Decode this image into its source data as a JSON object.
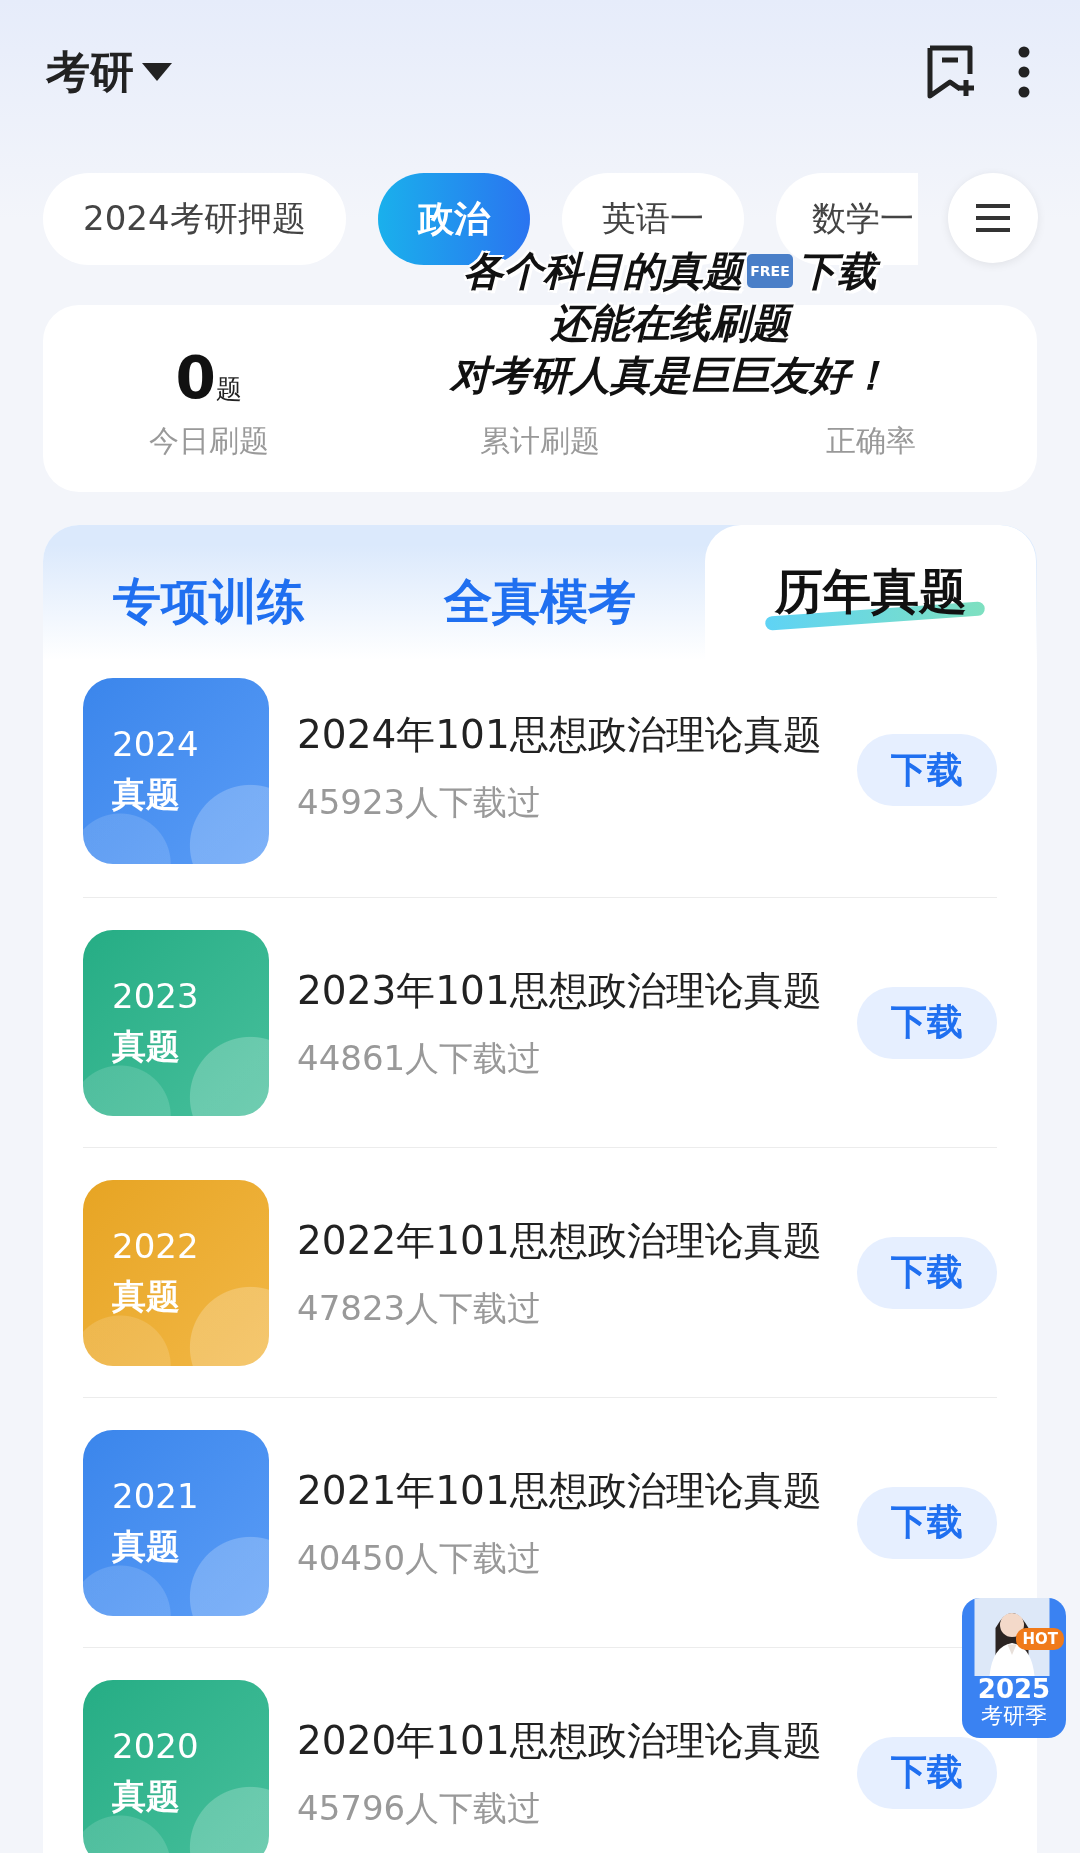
{
  "header": {
    "title": "考研"
  },
  "chips": [
    {
      "label": "2024考研押题",
      "selected": false
    },
    {
      "label": "政治",
      "selected": true
    },
    {
      "label": "英语一",
      "selected": false
    },
    {
      "label": "数学一",
      "selected": false
    }
  ],
  "stats": [
    {
      "value": "0",
      "unit": "题",
      "label": "今日刷题"
    },
    {
      "label": "累计刷题"
    },
    {
      "label": "正确率"
    }
  ],
  "caption": {
    "lines": [
      {
        "segments": [
          {
            "text": "各个科目的真题",
            "kind": "text"
          },
          {
            "text": "FREE",
            "kind": "badge"
          },
          {
            "text": "下载",
            "kind": "text"
          }
        ]
      },
      {
        "segments": [
          {
            "text": "还能在线刷题",
            "kind": "text"
          }
        ]
      },
      {
        "segments": [
          {
            "text": "对考研人真是巨巨友好！",
            "kind": "text"
          }
        ]
      }
    ]
  },
  "tabs": [
    {
      "label": "专项训练",
      "selected": false
    },
    {
      "label": "全真模考",
      "selected": false
    },
    {
      "label": "历年真题",
      "selected": true
    }
  ],
  "papers": [
    {
      "year": "2024",
      "tag": "真题",
      "color": "#3d8bf5",
      "title": "2024年101思想政治理论真题",
      "downloads": "45923人下载过",
      "button": "下载"
    },
    {
      "year": "2023",
      "tag": "真题",
      "color": "#27b48a",
      "title": "2023年101思想政治理论真题",
      "downloads": "44861人下载过",
      "button": "下载"
    },
    {
      "year": "2022",
      "tag": "真题",
      "color": "#f0ab25",
      "title": "2022年101思想政治理论真题",
      "downloads": "47823人下载过",
      "button": "下载"
    },
    {
      "year": "2021",
      "tag": "真题",
      "color": "#3d8bf5",
      "title": "2021年101思想政治理论真题",
      "downloads": "40450人下载过",
      "button": "下载"
    },
    {
      "year": "2020",
      "tag": "真题",
      "color": "#27b48a",
      "title": "2020年101思想政治理论真题",
      "downloads": "45796人下载过",
      "button": "下载"
    }
  ],
  "promo": {
    "badge": "HOT",
    "year": "2025",
    "label": "考研季"
  }
}
